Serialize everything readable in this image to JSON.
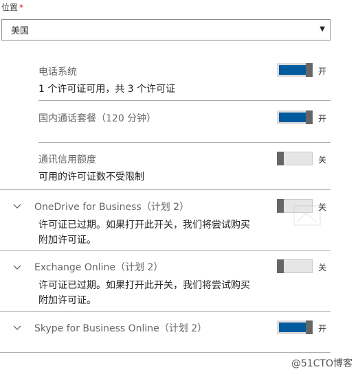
{
  "location": {
    "label": "位置",
    "required_mark": "*",
    "value": "美国"
  },
  "services": [
    {
      "title": "电话系统",
      "description": "1 个许可证可用，共 3 个许可证",
      "toggle_on": true,
      "state_label": "开",
      "expandable": false
    },
    {
      "title": "国内通话套餐（120 分钟）",
      "description": "",
      "toggle_on": true,
      "state_label": "开",
      "expandable": false
    },
    {
      "title": "通讯信用额度",
      "description": "可用的许可证数不受限制",
      "toggle_on": false,
      "state_label": "关",
      "expandable": false
    },
    {
      "title": "OneDrive for Business（计划 2）",
      "description_line1": "许可证已过期。如果打开此开关，我们将尝试购买",
      "description_line2": "附加许可证。",
      "toggle_on": false,
      "state_label": "关",
      "expandable": true
    },
    {
      "title": "Exchange Online（计划 2）",
      "description_line1": "许可证已过期。如果打开此开关，我们将尝试购买",
      "description_line2": "附加许可证。",
      "toggle_on": false,
      "state_label": "关",
      "expandable": true
    },
    {
      "title": "Skype for Business Online（计划 2）",
      "description": "",
      "toggle_on": true,
      "state_label": "开",
      "expandable": true
    }
  ],
  "watermark": "@51CTO博客",
  "colors": {
    "toggle_on": "#005a9e",
    "toggle_off": "#e6e6e6",
    "knob": "#666666",
    "required": "#e81123"
  }
}
